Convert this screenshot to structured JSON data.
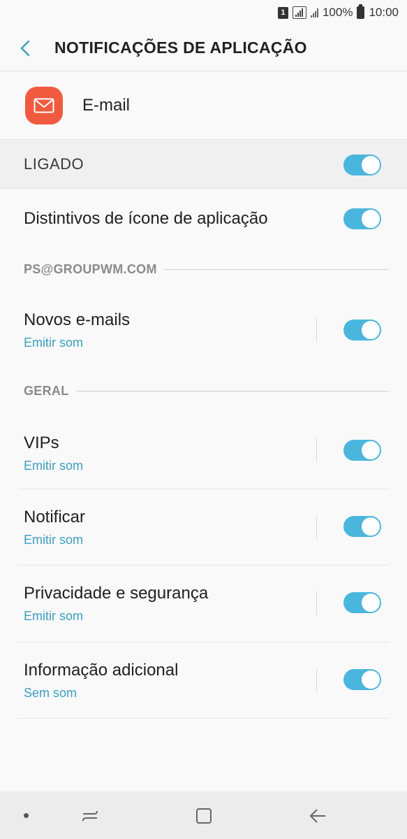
{
  "status_bar": {
    "sim": "1",
    "battery": "100%",
    "time": "10:00"
  },
  "app_bar": {
    "title": "NOTIFICAÇÕES DE APLICAÇÃO",
    "back_icon": "chevron-left-icon"
  },
  "app": {
    "name": "E-mail",
    "icon": "envelope-icon",
    "icon_color": "#f05a3f"
  },
  "master_switch": {
    "label": "LIGADO",
    "on": true
  },
  "badges_row": {
    "title": "Distintivos de ícone de aplicação",
    "on": true
  },
  "sections": [
    {
      "header": "PS@GROUPWM.COM",
      "items": [
        {
          "title": "Novos e-mails",
          "subtitle": "Emitir som",
          "on": true
        }
      ]
    },
    {
      "header": "GERAL",
      "items": [
        {
          "title": "VIPs",
          "subtitle": "Emitir som",
          "on": true
        },
        {
          "title": "Notificar",
          "subtitle": "Emitir som",
          "on": true
        },
        {
          "title": "Privacidade e segurança",
          "subtitle": "Emitir som",
          "on": true
        },
        {
          "title": "Informação adicional",
          "subtitle": "Sem som",
          "on": true
        }
      ]
    }
  ],
  "colors": {
    "accent": "#4ab6dd",
    "subtitle": "#3c9ebf"
  },
  "nav_bar": {
    "items": [
      "recents-icon",
      "home-icon",
      "back-icon"
    ]
  }
}
